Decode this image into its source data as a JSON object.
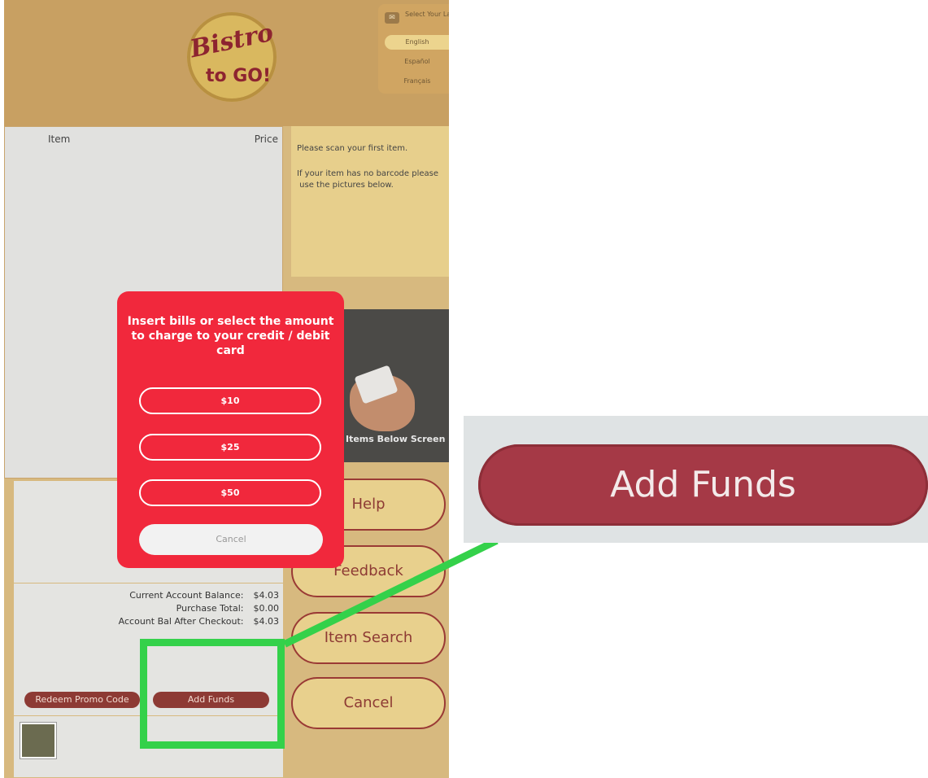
{
  "logo": {
    "line1": "Bistro",
    "line2": "to GO!"
  },
  "language": {
    "title": "Select Your Language",
    "options": [
      "English",
      "Español",
      "Français"
    ],
    "selected": "English"
  },
  "cart": {
    "header_item": "Item",
    "header_price": "Price"
  },
  "totals": {
    "rows": [
      {
        "label": "Current Account Balance:",
        "value": "$4.03"
      },
      {
        "label": "Purchase Total:",
        "value": "$0.00"
      },
      {
        "label": "Account Bal After Checkout:",
        "value": "$4.03"
      }
    ],
    "promo_label": "Redeem Promo Code",
    "add_funds_label": "Add Funds"
  },
  "messages": {
    "scan": "Please scan your first item.",
    "no_barcode": "If your item has no barcode please\n use the pictures below."
  },
  "photo_caption": "Items Below Screen",
  "side_buttons": {
    "help": "Help",
    "feedback": "Feedback",
    "item_search": "Item Search",
    "cancel": "Cancel"
  },
  "modal": {
    "title": "Insert bills or select the amount to charge to your credit / debit card",
    "amounts": [
      "$10",
      "$25",
      "$50"
    ],
    "cancel": "Cancel"
  },
  "zoom": {
    "label": "Add Funds"
  },
  "colors": {
    "modal_red": "#f1283c",
    "button_maroon": "#8d3a34",
    "highlight_green": "#34d14a",
    "kiosk_gold": "#d7b97f"
  }
}
